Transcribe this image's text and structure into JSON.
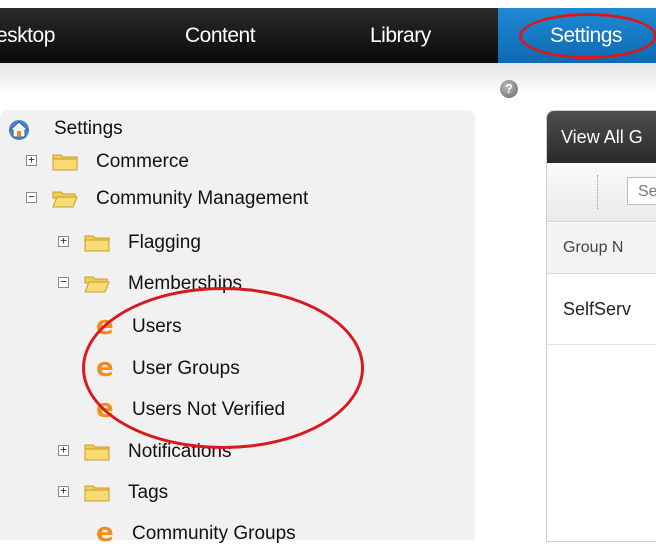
{
  "nav": {
    "tabs": [
      {
        "label": "esktop"
      },
      {
        "label": "Content"
      },
      {
        "label": "Library"
      },
      {
        "label": "Settings"
      }
    ],
    "active_color": "#1479c4",
    "highlight_color": "#d9191f"
  },
  "help_icon": {
    "glyph": "?"
  },
  "tree": {
    "root": "Settings",
    "items": [
      {
        "label": "Commerce"
      },
      {
        "label": "Community Management"
      },
      {
        "label": "Flagging"
      },
      {
        "label": "Memberships"
      },
      {
        "label": "Users"
      },
      {
        "label": "User Groups"
      },
      {
        "label": "Users Not Verified"
      },
      {
        "label": "Notifications"
      },
      {
        "label": "Tags"
      },
      {
        "label": "Community Groups"
      }
    ],
    "toggle_plus": "+",
    "toggle_minus": "−",
    "leaf_icon": "e"
  },
  "right_panel": {
    "header": "View All G",
    "search_placeholder": "Se",
    "column_header": "Group N",
    "row_value": "SelfServ"
  }
}
